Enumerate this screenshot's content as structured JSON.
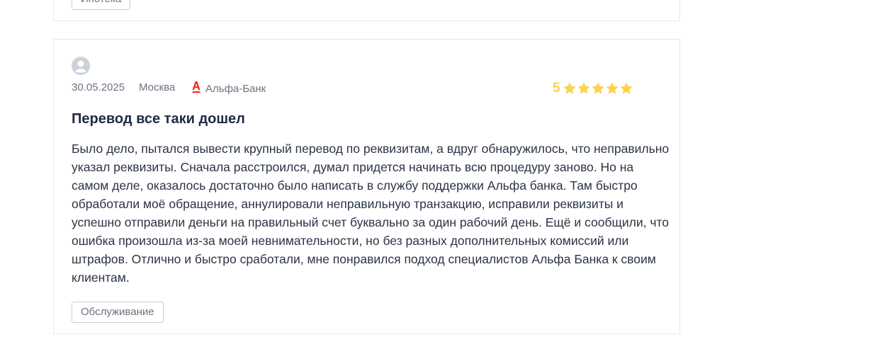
{
  "previous_review": {
    "tag_label": "Ипотека"
  },
  "review": {
    "date": "30.05.2025",
    "city": "Москва",
    "bank": "Альфа-Банк",
    "rating": "5",
    "rating_value": 5,
    "rating_max": 5,
    "title": "Перевод все таки дошел",
    "text": "Было дело, пытался вывести крупный перевод по реквизитам, а вдруг обнаружилось, что неправильно указал реквизиты. Сначала расстроился, думал придется начинать всю процедуру заново. Но на самом деле, оказалось достаточно было написать в службу поддержки Альфа банка. Там быстро обработали моё обращение, аннулировали неправильную транзакцию, исправили реквизиты и успешно отправили деньги на правильный счет буквально за один рабочий день. Ещё и сообщили, что ошибка произошла из-за моей невнимательности, но без разных дополнительных комиссий или штрафов. Отлично и быстро сработали, мне понравился подход специалистов Альфа Банка к своим клиентам.",
    "tag_label": "Обслуживание"
  },
  "icons": {
    "avatar": "user-avatar-icon",
    "bank_logo": "alfa-bank-logo-icon",
    "star": "star-icon"
  },
  "colors": {
    "star": "#fcd34d",
    "bank_logo": "#ef3124",
    "muted_text": "#6b7280",
    "title_text": "#1f2a44"
  }
}
